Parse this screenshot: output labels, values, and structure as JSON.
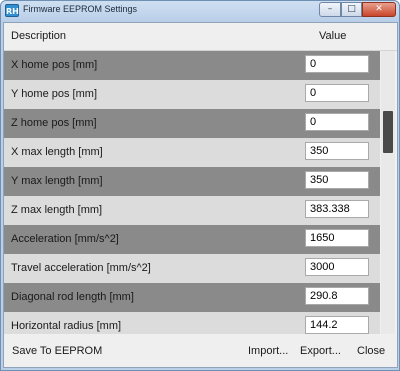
{
  "window": {
    "title": "Firmware EEPROM Settings",
    "app_icon_text": "RH",
    "minimize_glyph": "–",
    "maximize_glyph": "□",
    "close_glyph": "✕"
  },
  "table": {
    "headers": {
      "description": "Description",
      "value": "Value"
    },
    "rows": [
      {
        "label": "X home pos [mm]",
        "value": "0"
      },
      {
        "label": "Y home pos [mm]",
        "value": "0"
      },
      {
        "label": "Z home pos [mm]",
        "value": "0"
      },
      {
        "label": "X max length [mm]",
        "value": "350"
      },
      {
        "label": "Y max length [mm]",
        "value": "350"
      },
      {
        "label": "Z max length [mm]",
        "value": "383.338"
      },
      {
        "label": "Acceleration [mm/s^2]",
        "value": "1650"
      },
      {
        "label": "Travel acceleration [mm/s^2]",
        "value": "3000"
      },
      {
        "label": "Diagonal rod length [mm]",
        "value": "290.8"
      },
      {
        "label": "Horizontal radius [mm]",
        "value": "144.2"
      }
    ]
  },
  "footer": {
    "save_label": "Save To EEPROM",
    "import_label": "Import...",
    "export_label": "Export...",
    "close_label": "Close"
  }
}
